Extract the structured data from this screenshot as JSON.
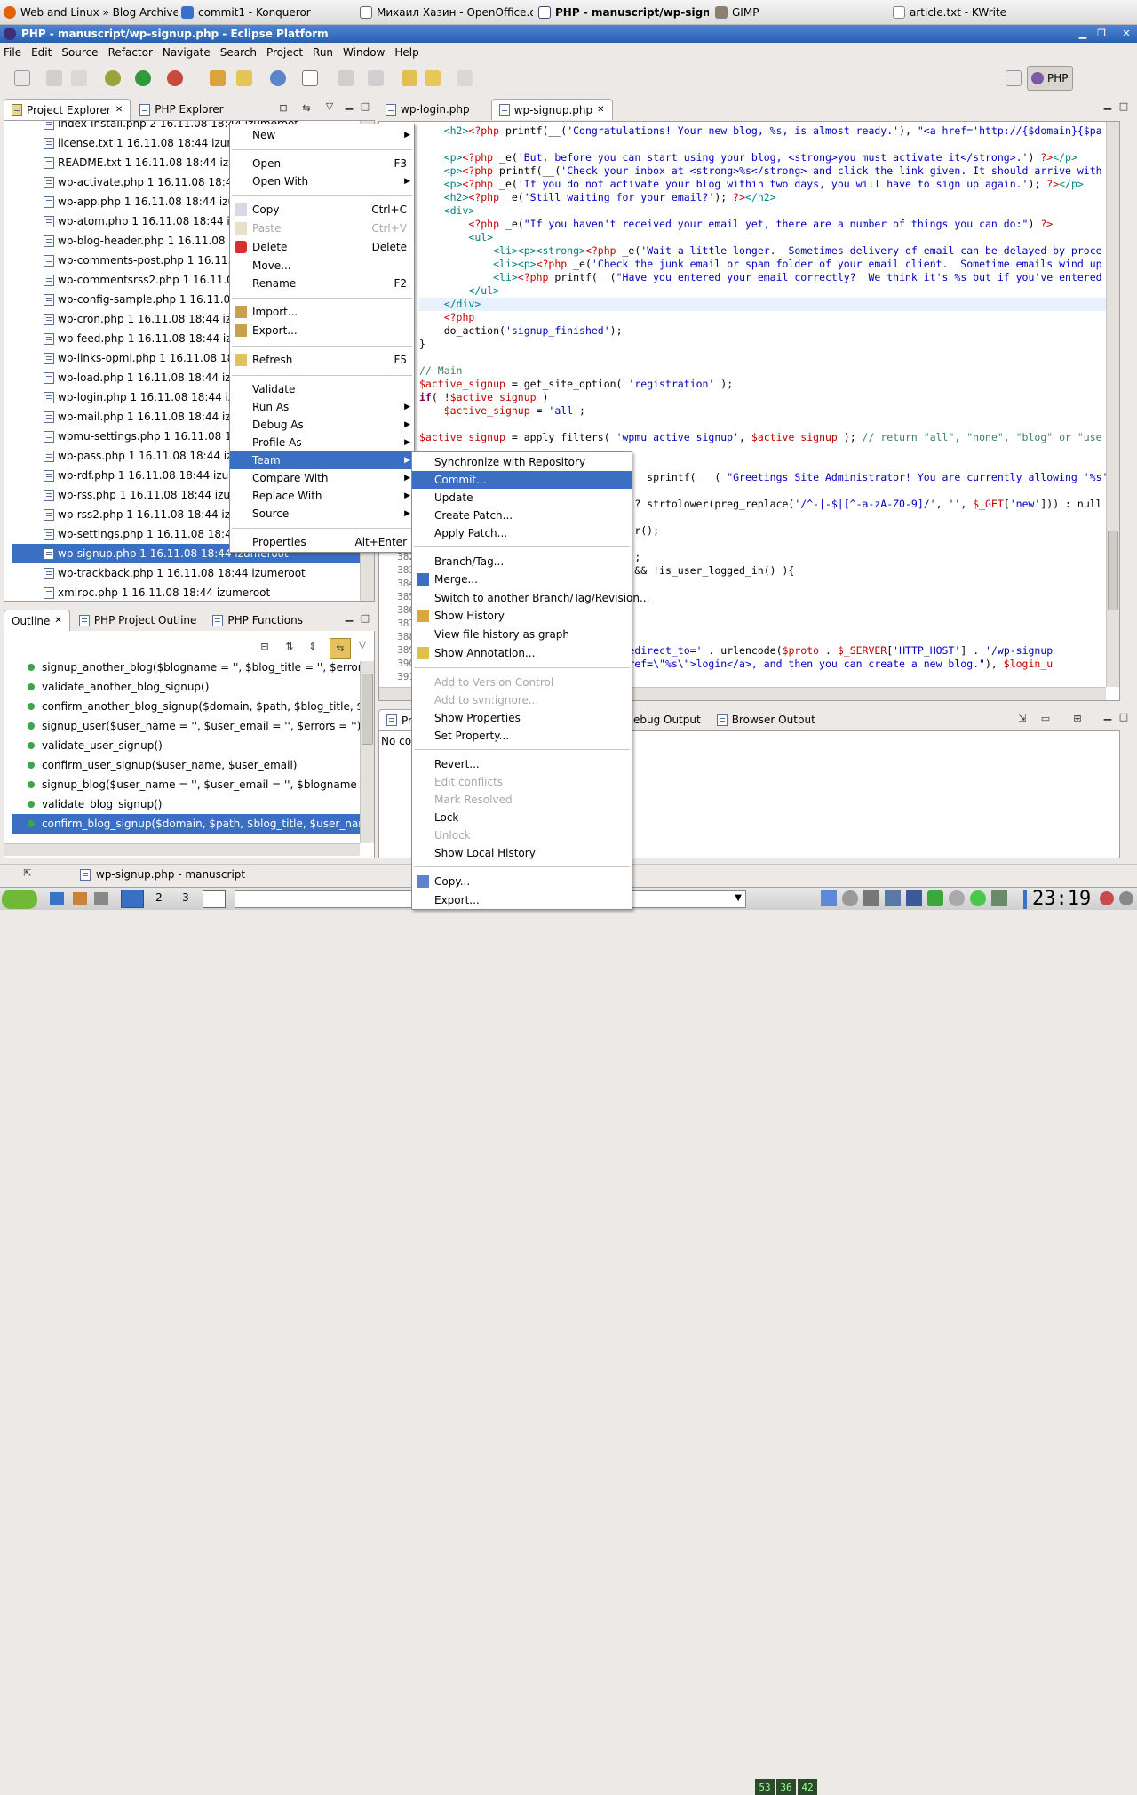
{
  "taskbar": {
    "tasks": [
      {
        "label": "Web and Linux » Blog Archive"
      },
      {
        "label": "commit1 - Konqueror"
      },
      {
        "label": "Михаил Хазин - OpenOffice.org"
      },
      {
        "label": "PHP - manuscript/wp-signup.ph"
      },
      {
        "label": "GIMP"
      },
      {
        "label": "article.txt - KWrite"
      }
    ]
  },
  "window": {
    "title": "PHP - manuscript/wp-signup.php - Eclipse Platform"
  },
  "menubar": [
    "File",
    "Edit",
    "Source",
    "Refactor",
    "Navigate",
    "Search",
    "Project",
    "Run",
    "Window",
    "Help"
  ],
  "perspective": {
    "label": "PHP"
  },
  "explorer": {
    "tabs": [
      "Project Explorer",
      "PHP Explorer"
    ],
    "files": [
      "index-install.php 2  16.11.08 18:44  izumeroot",
      "license.txt 1  16.11.08 18:44  izumeroot",
      "README.txt 1  16.11.08 18:44  izumeroot",
      "wp-activate.php 1  16.11.08 18:44  izumeroot",
      "wp-app.php 1  16.11.08 18:44  izumeroot",
      "wp-atom.php 1  16.11.08 18:44  izumeroot",
      "wp-blog-header.php 1  16.11.08 18:44  izumeroot",
      "wp-comments-post.php 1  16.11.08 18:44  izumeroot",
      "wp-commentsrss2.php 1  16.11.08 18:44  izumeroot",
      "wp-config-sample.php 1  16.11.08 18:44  izumeroot",
      "wp-cron.php 1  16.11.08 18:44  izumeroot",
      "wp-feed.php 1  16.11.08 18:44  izumeroot",
      "wp-links-opml.php 1  16.11.08 18:44  izumeroot",
      "wp-load.php 1  16.11.08 18:44  izumeroot",
      "wp-login.php 1  16.11.08 18:44  izumeroot",
      "wp-mail.php 1  16.11.08 18:44  izumeroot",
      "wpmu-settings.php 1  16.11.08 18:44  izumeroot",
      "wp-pass.php 1  16.11.08 18:44  izumeroot",
      "wp-rdf.php 1  16.11.08 18:44  izumeroot",
      "wp-rss.php 1  16.11.08 18:44  izumeroot",
      "wp-rss2.php 1  16.11.08 18:44  izumeroot",
      "wp-settings.php 1  16.11.08 18:44  izumeroot",
      "wp-signup.php 1  16.11.08 18:44  izumeroot",
      "wp-trackback.php 1  16.11.08 18:44  izumeroot",
      "xmlrpc.php 1  16.11.08 18:44  izumeroot"
    ]
  },
  "outline": {
    "tabs": [
      "Outline",
      "PHP Project Outline",
      "PHP Functions"
    ],
    "items": [
      "signup_another_blog($blogname = '', $blog_title = '', $errors = '')",
      "validate_another_blog_signup()",
      "confirm_another_blog_signup($domain, $path, $blog_title, $user_name, $user_email, $meta)",
      "signup_user($user_name = '', $user_email = '', $errors = '')",
      "validate_user_signup()",
      "confirm_user_signup($user_name, $user_email)",
      "signup_blog($user_name = '', $user_email = '', $blogname = '', $blog_title = '', $errors = '')",
      "validate_blog_signup()",
      "confirm_blog_signup($domain, $path, $blog_title, $user_name, $user_email, $meta)"
    ]
  },
  "editor": {
    "tabs": [
      "wp-login.php",
      "wp-signup.php"
    ],
    "line_numbers": [
      "382",
      "383",
      "384",
      "385",
      "386",
      "387",
      "388",
      "389",
      "390",
      "391"
    ]
  },
  "bottom_panel": {
    "tabs": [
      "Pr",
      "ebug Output",
      "Browser Output"
    ],
    "content": "No co"
  },
  "context_menu": {
    "items": [
      {
        "label": "New",
        "accel": "",
        "submenu": true
      },
      {
        "label": "Open",
        "accel": "F3"
      },
      {
        "label": "Open With",
        "accel": "",
        "submenu": true
      },
      {
        "label": "Copy",
        "accel": "Ctrl+C"
      },
      {
        "label": "Paste",
        "accel": "Ctrl+V",
        "disabled": true
      },
      {
        "label": "Delete",
        "accel": "Delete"
      },
      {
        "label": "Move...",
        "accel": ""
      },
      {
        "label": "Rename",
        "accel": "F2"
      },
      {
        "label": "Import...",
        "accel": ""
      },
      {
        "label": "Export...",
        "accel": ""
      },
      {
        "label": "Refresh",
        "accel": "F5"
      },
      {
        "label": "Validate",
        "accel": ""
      },
      {
        "label": "Run As",
        "accel": "",
        "submenu": true
      },
      {
        "label": "Debug As",
        "accel": "",
        "submenu": true
      },
      {
        "label": "Profile As",
        "accel": "",
        "submenu": true
      },
      {
        "label": "Team",
        "accel": "",
        "submenu": true
      },
      {
        "label": "Compare With",
        "accel": "",
        "submenu": true
      },
      {
        "label": "Replace With",
        "accel": "",
        "submenu": true
      },
      {
        "label": "Source",
        "accel": "",
        "submenu": true
      },
      {
        "label": "Properties",
        "accel": "Alt+Enter"
      }
    ]
  },
  "team_submenu": {
    "items": [
      "Synchronize with Repository",
      "Commit...",
      "Update",
      "Create Patch...",
      "Apply Patch...",
      "Branch/Tag...",
      "Merge...",
      "Switch to another Branch/Tag/Revision...",
      "Show History",
      "View file history as graph",
      "Show Annotation...",
      "Add to Version Control",
      "Add to svn:ignore...",
      "Show Properties",
      "Set Property...",
      "Revert...",
      "Edit conflicts",
      "Mark Resolved",
      "Lock",
      "Unlock",
      "Show Local History",
      "Copy...",
      "Export..."
    ]
  },
  "status": {
    "file": "wp-signup.php - manuscript"
  },
  "system_tray": {
    "clock": "23:19",
    "desktops": [
      "2",
      "3"
    ],
    "indicators": [
      "53",
      "36",
      "42"
    ]
  }
}
